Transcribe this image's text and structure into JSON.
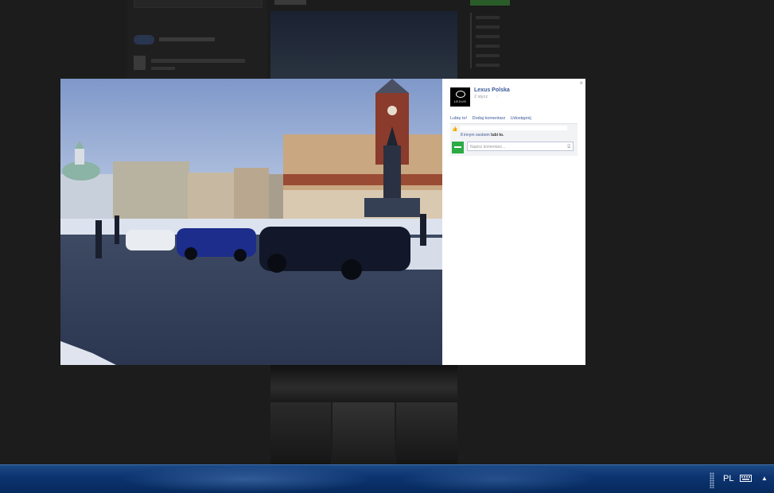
{
  "viewer": {
    "close": "×",
    "post": {
      "page_name": "Lexus Polska",
      "avatar_word": "LEXUS",
      "date": "2 stycz",
      "globe": "◌"
    },
    "actions": [
      "Lubię to!",
      "Dodaj komentarz",
      "Udostępnij"
    ],
    "likes_icon": "👍",
    "likes": {
      "count": "8 innym osobom",
      "suffix": "lubi to."
    },
    "comment_placeholder": "Napisz komentarz..."
  },
  "taskbar": {
    "language": "PL",
    "tray_arrow": "▲"
  }
}
